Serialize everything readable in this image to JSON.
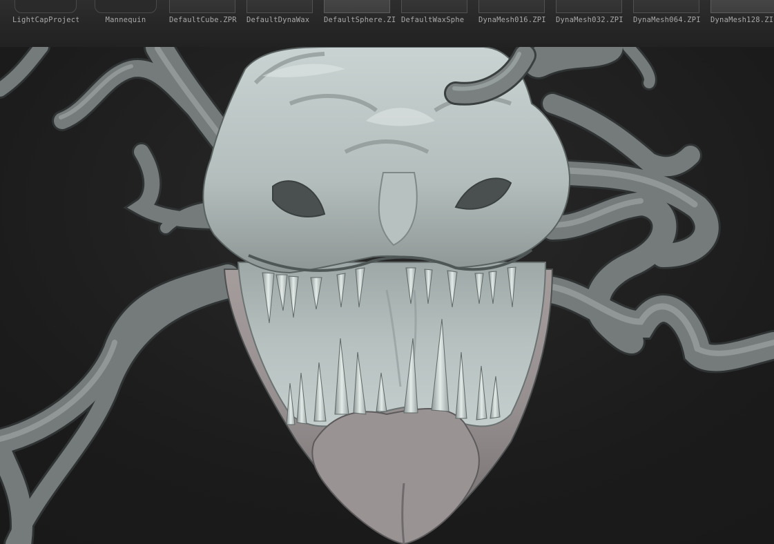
{
  "lightbox": {
    "folders": [
      {
        "label": "LightCapProjects",
        "icon": "folder-icon"
      },
      {
        "label": "Mannequin",
        "icon": "folder-icon"
      }
    ],
    "files": [
      {
        "label": "DefaultCube.ZPR",
        "thumb": "file-thumbnail"
      },
      {
        "label": "DefaultDynaWax",
        "thumb": "file-thumbnail"
      },
      {
        "label": "DefaultSphere.ZI",
        "thumb": "file-thumbnail"
      },
      {
        "label": "DefaultWaxSphe",
        "thumb": "file-thumbnail"
      },
      {
        "label": "DynaMesh016.ZPI",
        "thumb": "file-thumbnail"
      },
      {
        "label": "DynaMesh032.ZPI",
        "thumb": "file-thumbnail"
      },
      {
        "label": "DynaMesh064.ZPI",
        "thumb": "file-thumbnail"
      },
      {
        "label": "DynaMesh128.ZI",
        "thumb": "file-thumbnail"
      }
    ]
  },
  "viewport": {
    "subject": "sculpt-model",
    "colors": {
      "background": "#1c1c1c",
      "skin_light": "#b9c4c3",
      "skin_mid": "#8e9897",
      "tentacle": "#6f7474",
      "shadow": "#3c4040"
    }
  }
}
